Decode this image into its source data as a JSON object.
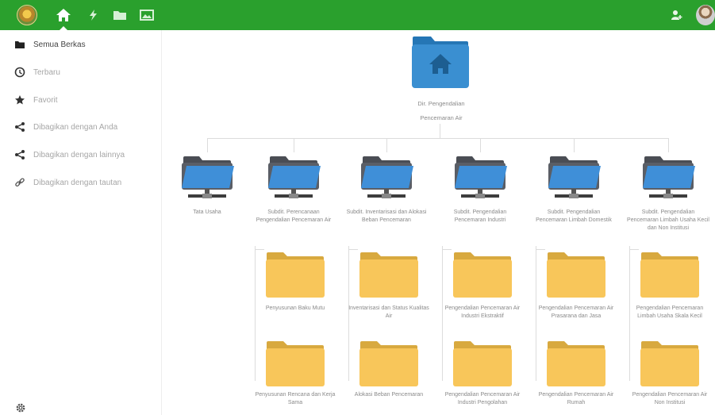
{
  "colors": {
    "topbar": "#2aa02d",
    "folder_blue": "#2f86c9",
    "folder_yellow": "#f8c65a"
  },
  "topbar": {
    "nav": [
      {
        "icon": "home-icon"
      },
      {
        "icon": "activity-icon"
      },
      {
        "icon": "folder-icon"
      },
      {
        "icon": "gallery-icon"
      }
    ],
    "right": [
      {
        "icon": "user-icon"
      },
      {
        "icon": "avatar"
      }
    ]
  },
  "sidebar": {
    "items": [
      {
        "label": "Semua Berkas",
        "icon": "folder-icon"
      },
      {
        "label": "Terbaru",
        "icon": "clock-icon"
      },
      {
        "label": "Favorit",
        "icon": "star-icon"
      },
      {
        "label": "Dibagikan dengan Anda",
        "icon": "share-icon"
      },
      {
        "label": "Dibagikan dengan lainnya",
        "icon": "share-icon"
      },
      {
        "label": "Dibagikan dengan tautan",
        "icon": "link-icon"
      }
    ],
    "settings_icon": "gear-icon"
  },
  "tree": {
    "root": {
      "label_line1": "Dir. Pengendalian",
      "label_line2": "Pencemaran Air"
    },
    "level1": [
      {
        "label": "Tata Usaha"
      },
      {
        "label": "Subdit. Perencanaan Pengendalian Pencemaran Air"
      },
      {
        "label": "Subdit. Inventarisasi dan Alokasi Beban Pencemaran"
      },
      {
        "label": "Subdit. Pengendalian Pencemaran Industri"
      },
      {
        "label": "Subdit. Pengendalian Pencemaran Limbah Domestik"
      },
      {
        "label": "Subdit. Pengendalian Pencemaran Limbah Usaha Kecil dan Non Institusi"
      }
    ],
    "level2_row1": [
      {
        "label": "Penyusunan Baku Mutu"
      },
      {
        "label": "Inventarisasi dan Status Kualitas Air"
      },
      {
        "label": "Pengendalian Pencemaran Air Industri Ekstraktif"
      },
      {
        "label": "Pengendalian Pencemaran Air Prasarana dan Jasa"
      },
      {
        "label": "Pengendalian Pencemaran Limbah Usaha Skala Kecil"
      }
    ],
    "level2_row2": [
      {
        "label": "Penyusunan Rencana dan Kerja Sama"
      },
      {
        "label": "Alokasi Beban Pencemaran"
      },
      {
        "label": "Pengendalian Pencemaran Air Industri Pengolahan"
      },
      {
        "label": "Pengendalian Pencemaran Air Rumah"
      },
      {
        "label": "Pengendalian Pencemaran Air Non Institusi"
      }
    ]
  }
}
